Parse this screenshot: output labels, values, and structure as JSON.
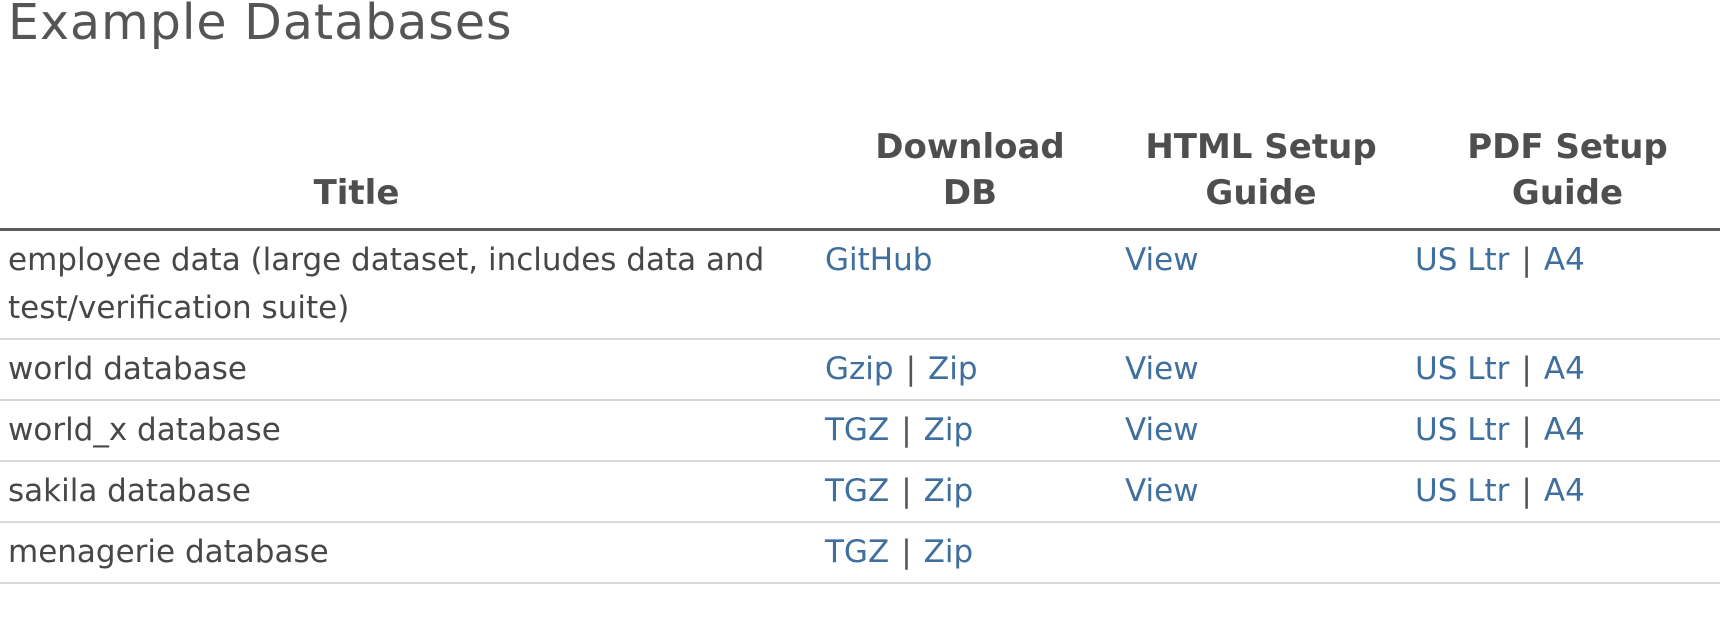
{
  "page": {
    "title": "Example Databases"
  },
  "table": {
    "headers": {
      "title": "Title",
      "download_line1": "Download",
      "download_line2": "DB",
      "html_line1": "HTML Setup",
      "html_line2": "Guide",
      "pdf_line1": "PDF Setup",
      "pdf_line2": "Guide"
    },
    "separator": "|",
    "rows": [
      {
        "title": "employee data (large dataset, includes data and test/verification suite)",
        "download": {
          "link1": "GitHub",
          "link2": ""
        },
        "html": "View",
        "pdf": {
          "link1": "US Ltr",
          "link2": "A4"
        }
      },
      {
        "title": "world database",
        "download": {
          "link1": "Gzip",
          "link2": "Zip"
        },
        "html": "View",
        "pdf": {
          "link1": "US Ltr",
          "link2": "A4"
        }
      },
      {
        "title": "world_x database",
        "download": {
          "link1": "TGZ",
          "link2": "Zip"
        },
        "html": "View",
        "pdf": {
          "link1": "US Ltr",
          "link2": "A4"
        }
      },
      {
        "title": "sakila database",
        "download": {
          "link1": "TGZ",
          "link2": "Zip"
        },
        "html": "View",
        "pdf": {
          "link1": "US Ltr",
          "link2": "A4"
        }
      },
      {
        "title": "menagerie database",
        "download": {
          "link1": "TGZ",
          "link2": "Zip"
        },
        "html": "",
        "pdf": {
          "link1": "",
          "link2": ""
        }
      }
    ]
  },
  "colors": {
    "link": "#3f6f9e",
    "text": "#474747",
    "header_rule": "#5b5b5b",
    "row_rule": "#d9d9d9"
  }
}
